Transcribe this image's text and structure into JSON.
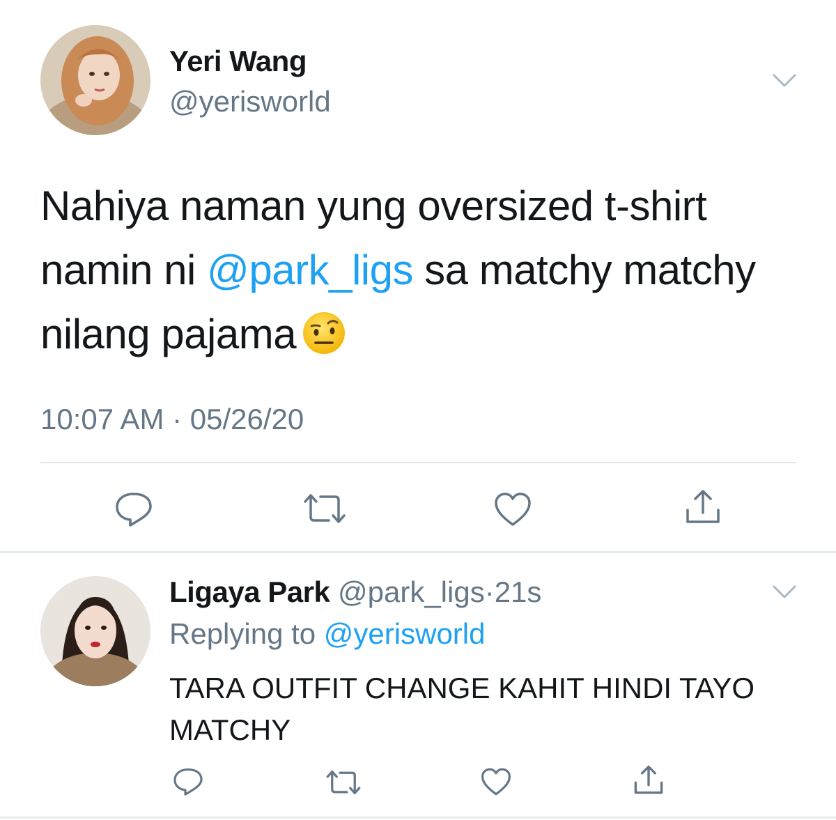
{
  "main_tweet": {
    "author_name": "Yeri Wang",
    "author_handle": "@yerisworld",
    "text_before_mention": "Nahiya naman yung oversized t-shirt namin ni ",
    "mention": "@park_ligs",
    "text_after_mention": " sa matchy matchy nilang pajama",
    "emoji": "face-with-raised-eyebrow-icon",
    "timestamp": "10:07 AM · 05/26/20",
    "actions": [
      "reply-icon",
      "retweet-icon",
      "like-icon",
      "share-icon"
    ]
  },
  "reply_tweet": {
    "author_name": "Ligaya Park",
    "author_handle": "@park_ligs",
    "separator": "·",
    "time_ago": "21s",
    "replying_prefix": "Replying to ",
    "replying_handle": "@yerisworld",
    "text": "TARA OUTFIT CHANGE KAHIT HINDI TAYO MATCHY",
    "actions": [
      "reply-icon",
      "retweet-icon",
      "like-icon",
      "share-icon"
    ]
  },
  "colors": {
    "link": "#1da1f2",
    "secondary_text": "#657786",
    "primary_text": "#14171a",
    "divider": "#e6ecf0",
    "icon": "#657786"
  }
}
